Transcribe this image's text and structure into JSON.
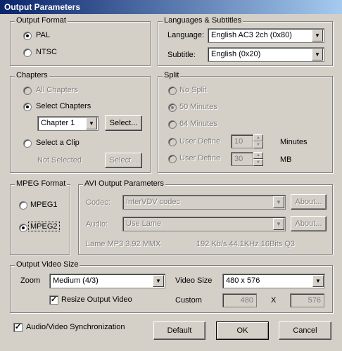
{
  "window": {
    "title": "Output Parameters"
  },
  "output_format": {
    "legend": "Output Format",
    "options": [
      {
        "label": "PAL",
        "selected": true
      },
      {
        "label": "NTSC",
        "selected": false
      }
    ]
  },
  "languages": {
    "legend": "Languages & Subtitles",
    "language_label": "Language:",
    "language_value": "English AC3 2ch (0x80)",
    "subtitle_label": "Subtitle:",
    "subtitle_value": "English (0x20)"
  },
  "chapters": {
    "legend": "Chapters",
    "all_label": "All Chapters",
    "select_label": "Select Chapters",
    "chapter_value": "Chapter 1",
    "select_button": "Select...",
    "clip_label": "Select a Clip",
    "not_selected": "Not Selected",
    "clip_button": "Select..."
  },
  "split": {
    "legend": "Split",
    "no_split": "No Split",
    "min50": "50 Minutes",
    "min64": "64 Minutes",
    "user_define_1": "User Define",
    "user_value_1": "10",
    "user_unit_1": "Minutes",
    "user_define_2": "User Define",
    "user_value_2": "30",
    "user_unit_2": "MB"
  },
  "mpeg_format": {
    "legend": "MPEG Format",
    "options": [
      {
        "label": "MPEG1",
        "selected": false
      },
      {
        "label": "MPEG2",
        "selected": true
      }
    ]
  },
  "avi": {
    "legend": "AVI Output Parameters",
    "codec_label": "Codec:",
    "codec_value": "InterVDV codec",
    "codec_about": "About...",
    "audio_label": "Audio:",
    "audio_value": "Use Lame",
    "audio_about": "About...",
    "audio_info": "Lame MP3 3.92 MMX",
    "audio_rate": "192 Kb/s 44.1KHz 16Bits Q3"
  },
  "video_size": {
    "legend": "Output Video Size",
    "zoom_label": "Zoom",
    "zoom_value": "Medium  (4/3)",
    "size_label": "Video Size",
    "size_value": "480 x 576",
    "resize_label": "Resize Output Video",
    "resize_checked": "✓",
    "custom_label": "Custom",
    "custom_w": "480",
    "x_label": "X",
    "custom_h": "576"
  },
  "sync": {
    "label": "Audio/Video Synchronization",
    "checked": "✓"
  },
  "buttons": {
    "default": "Default",
    "ok": "OK",
    "cancel": "Cancel"
  },
  "icons": {
    "dropdown": "▼",
    "spin_up": "▲",
    "spin_down": "▼"
  }
}
